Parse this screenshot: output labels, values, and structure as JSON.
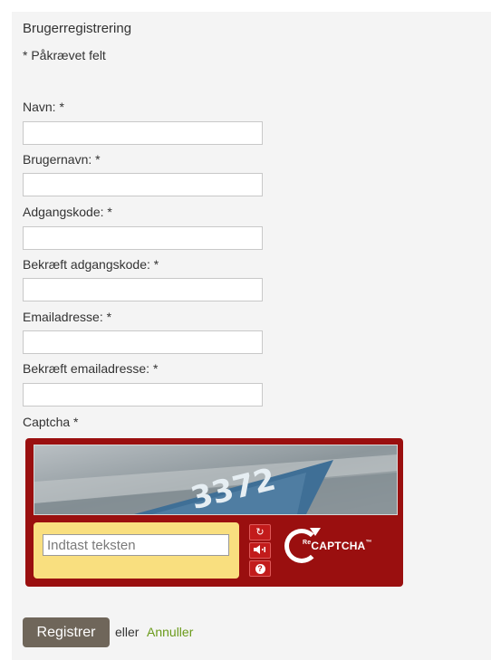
{
  "form": {
    "title": "Brugerregistrering",
    "required_note": "* Påkrævet felt",
    "fields": [
      {
        "label": "Navn: *",
        "value": ""
      },
      {
        "label": "Brugernavn: *",
        "value": ""
      },
      {
        "label": "Adgangskode: *",
        "value": ""
      },
      {
        "label": "Bekræft adgangskode: *",
        "value": ""
      },
      {
        "label": "Emailadresse: *",
        "value": ""
      },
      {
        "label": "Bekræft emailadresse: *",
        "value": ""
      }
    ],
    "captcha_label": "Captcha *"
  },
  "captcha": {
    "challenge_text": "3372",
    "input_placeholder": "Indtast teksten",
    "buttons": [
      "refresh-icon",
      "audio-icon",
      "help-icon"
    ],
    "logo_prefix": "Re",
    "logo_main": "CAPTCHA",
    "logo_tm": "™",
    "frame_color": "#9a0f0f",
    "answer_bg_color": "#f9df7f"
  },
  "actions": {
    "submit_label": "Registrer",
    "or_text": "eller",
    "cancel_label": "Annuller",
    "cancel_color": "#6a9a1a"
  }
}
